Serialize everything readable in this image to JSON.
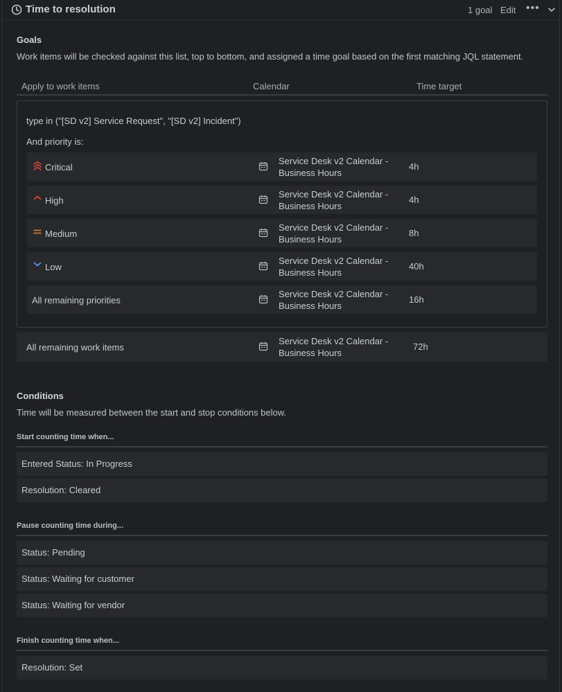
{
  "header": {
    "title": "Time to resolution",
    "goal_count": "1 goal",
    "edit_label": "Edit",
    "more_label": "•••"
  },
  "goals": {
    "title": "Goals",
    "description": "Work items will be checked against this list, top to bottom, and assigned a time goal based on the first matching JQL statement.",
    "columns": [
      "Apply to work items",
      "Calendar",
      "Time target"
    ],
    "group": {
      "jql": "type in (\"[SD v2] Service Request\", \"[SD v2] Incident\")",
      "priority_label": "And priority is:",
      "rows": [
        {
          "priority": "Critical",
          "icon": "priority-critical-icon",
          "calendar": "Service Desk v2 Calendar - Business Hours",
          "target": "4h"
        },
        {
          "priority": "High",
          "icon": "priority-high-icon",
          "calendar": "Service Desk v2 Calendar - Business Hours",
          "target": "4h"
        },
        {
          "priority": "Medium",
          "icon": "priority-medium-icon",
          "calendar": "Service Desk v2 Calendar - Business Hours",
          "target": "8h"
        },
        {
          "priority": "Low",
          "icon": "priority-low-icon",
          "calendar": "Service Desk v2 Calendar - Business Hours",
          "target": "40h"
        },
        {
          "priority": "All remaining priorities",
          "icon": "",
          "calendar": "Service Desk v2 Calendar - Business Hours",
          "target": "16h"
        }
      ]
    },
    "remaining": {
      "label": "All remaining work items",
      "calendar": "Service Desk v2 Calendar - Business Hours",
      "target": "72h"
    }
  },
  "conditions": {
    "title": "Conditions",
    "description": "Time will be measured between the start and stop conditions below.",
    "start": {
      "heading": "Start counting time when...",
      "items": [
        "Entered Status: In Progress",
        "Resolution: Cleared"
      ]
    },
    "pause": {
      "heading": "Pause counting time during...",
      "items": [
        "Status: Pending",
        "Status: Waiting for customer",
        "Status: Waiting for vendor"
      ]
    },
    "finish": {
      "heading": "Finish counting time when...",
      "items": [
        "Resolution: Set"
      ]
    }
  },
  "colors": {
    "critical": "#e2483d",
    "high": "#e2483d",
    "medium": "#e8812b",
    "low": "#579dff"
  }
}
